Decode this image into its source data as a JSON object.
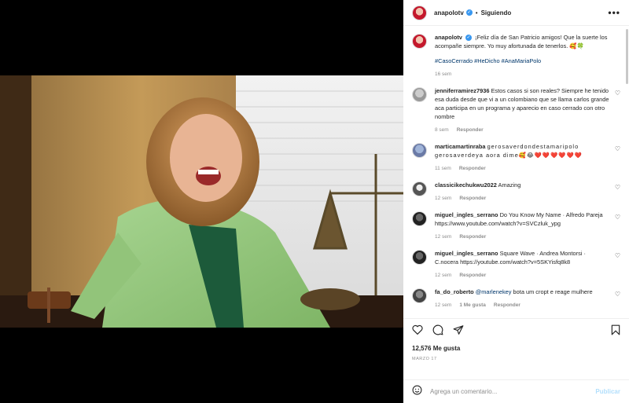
{
  "header": {
    "username": "anapolotv",
    "separator": "•",
    "follow_label": "Siguiendo",
    "more_label": "•••"
  },
  "caption": {
    "username": "anapolotv",
    "text": "¡Feliz día de San Patricio amigos! Que la suerte los acompañe siempre. Yo muy afortunada de tenerlos. 🥰🍀",
    "hashtags": "#CasoCerrado #HeDicho #AnaMariaPolo",
    "time": "16 sem"
  },
  "comments": [
    {
      "username": "jenniferramirez7936",
      "text": "Estos casos si son reales? Siempre he tenido esa duda desde que vi a un colombiano que se llama carlos grande aca participa en un programa y aparecio en caso cerrado con otro nombre",
      "time": "8 sem",
      "reply": "Responder"
    },
    {
      "username": "marticamartinraba",
      "text": "gerosaverdondestamaripolo gerosaverdeya aora dime🥰😂❤️❤️❤️❤️❤️❤️",
      "time": "11 sem",
      "reply": "Responder"
    },
    {
      "username": "classicikechukwu2022",
      "text": "Amazing",
      "time": "12 sem",
      "reply": "Responder"
    },
    {
      "username": "miguel_ingles_serrano",
      "text": "Do You Know My Name · Alfredo Pareja",
      "link": "https://www.youtube.com/watch?v=SVCzluk_ypg",
      "time": "12 sem",
      "reply": "Responder"
    },
    {
      "username": "miguel_ingles_serrano",
      "text": "Square Wave · Andrea Montorsi · C.nocera",
      "link": "https://youtube.com/watch?v=5SKYisfq8k8",
      "time": "12 sem",
      "reply": "Responder"
    },
    {
      "username": "fa_do_roberto",
      "mention": "@marlenekey",
      "text": "bota um cropt e reage mulhere",
      "time": "12 sem",
      "likes": "1 Me gusta",
      "reply": "Responder"
    }
  ],
  "footer": {
    "likes": "12,576 Me gusta",
    "date": "MARZO 17",
    "comment_placeholder": "Agrega un comentario...",
    "publish_label": "Publicar"
  },
  "colors": {
    "accent": "#3897f0",
    "link": "#00376b",
    "muted": "#8e8e8e",
    "publish_disabled": "#b2dffc"
  }
}
